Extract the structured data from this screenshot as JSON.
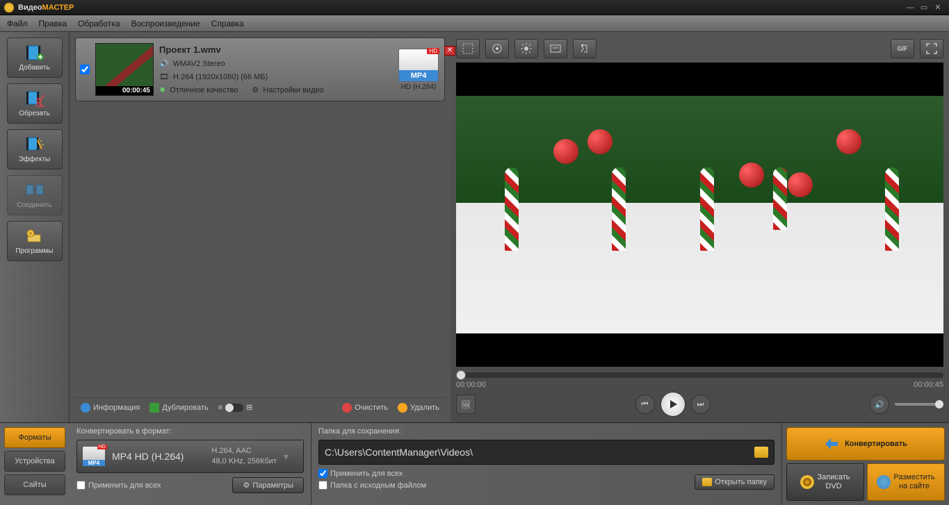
{
  "title": {
    "plain": "Видео",
    "accent": "МАСТЕР"
  },
  "menu": {
    "file": "Файл",
    "edit": "Правка",
    "process": "Обработка",
    "playback": "Воспроизведение",
    "help": "Справка"
  },
  "toolbar": {
    "add": "Добавить",
    "cut": "Обрезать",
    "effects": "Эффекты",
    "join": "Соединить",
    "programs": "Программы"
  },
  "file": {
    "name": "Проект 1.wmv",
    "audio": "WMAV2 Stereo",
    "video": "H.264 (1920x1080) (66 МБ)",
    "duration": "00:00:45",
    "quality": "Отличное качество",
    "settings": "Настройки видео",
    "format_badge": "MP4",
    "format_sub": "HD (H.264)",
    "hd": "HD"
  },
  "filelist_tb": {
    "info": "Информация",
    "dup": "Дублировать",
    "clear": "Очистить",
    "delete": "Удалить"
  },
  "time": {
    "start": "00:00:00",
    "end": "00:00:45"
  },
  "bottom_tabs": {
    "formats": "Форматы",
    "devices": "Устройства",
    "sites": "Сайты"
  },
  "format_section": {
    "label": "Конвертировать в формат:",
    "name": "MP4 HD (H.264)",
    "details1": "H.264, AAC",
    "details2": "48,0 KHz,  256Кбит",
    "badge": "MP4",
    "apply_all": "Применить для всех",
    "params": "Параметры"
  },
  "folder_section": {
    "label": "Папка для сохранения:",
    "path": "C:\\Users\\ContentManager\\Videos\\",
    "apply_all": "Применить для всех",
    "source_folder": "Папка с исходным файлом",
    "open_folder": "Открыть папку"
  },
  "actions": {
    "convert": "Конвертировать",
    "dvd1": "Записать",
    "dvd2": "DVD",
    "site1": "Разместить",
    "site2": "на сайте"
  },
  "preview_tb": {
    "gif": "GIF"
  }
}
